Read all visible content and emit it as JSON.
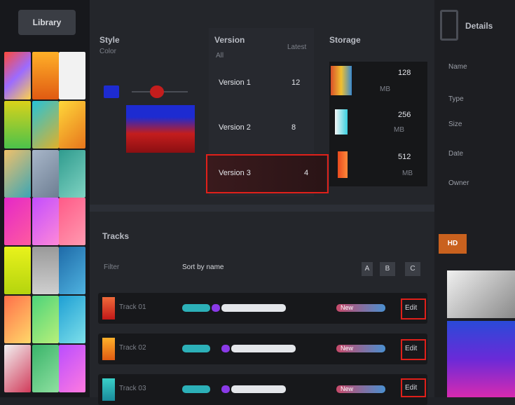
{
  "app": {
    "title": "Library"
  },
  "style_panel": {
    "title": "Style",
    "subtitle": "Color",
    "color_a": "#1d2bd1",
    "color_b": "#c41d1d"
  },
  "version_panel": {
    "title": "Version",
    "sub_label": "All",
    "header_value": "Latest",
    "rows": [
      {
        "name": "Version 1",
        "value": "12"
      },
      {
        "name": "Version 2",
        "value": "8"
      },
      {
        "name": "Version 3",
        "value": "4"
      }
    ]
  },
  "storage_panel": {
    "title": "Storage",
    "rows": [
      {
        "size": "128",
        "detail": "MB"
      },
      {
        "size": "256",
        "detail": "MB"
      },
      {
        "size": "512",
        "detail": "MB"
      }
    ]
  },
  "section": {
    "title": "Tracks"
  },
  "toolbar": {
    "filter_label": "Filter",
    "sort_label": "Sort by name",
    "view_a": "A",
    "view_b": "B",
    "view_c": "C"
  },
  "tracks": [
    {
      "name": "Track 01",
      "tag": "New",
      "action": "Edit"
    },
    {
      "name": "Track 02",
      "tag": "New",
      "action": "Edit"
    },
    {
      "name": "Track 03",
      "tag": "New",
      "action": "Edit"
    }
  ],
  "right_panel": {
    "title": "Details",
    "items": [
      "Name",
      "Type",
      "Size",
      "Date",
      "Owner"
    ],
    "badge": "HD"
  }
}
